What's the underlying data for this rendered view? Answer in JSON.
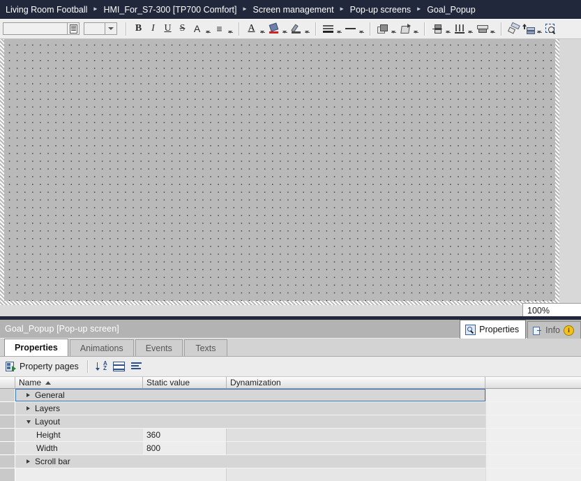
{
  "breadcrumb": {
    "items": [
      {
        "label": "Living Room Football"
      },
      {
        "label": "HMI_For_S7-300 [TP700 Comfort]"
      },
      {
        "label": "Screen management"
      },
      {
        "label": "Pop-up screens"
      },
      {
        "label": "Goal_Popup"
      }
    ],
    "separator": "▸"
  },
  "toolbar": {
    "font_name_value": "",
    "font_name_placeholder": "",
    "font_size_value": "",
    "buttons": [
      {
        "name": "bold",
        "glyph": "B"
      },
      {
        "name": "italic",
        "glyph": "I"
      },
      {
        "name": "underline",
        "glyph": "U"
      },
      {
        "name": "strikethrough",
        "glyph": "S"
      },
      {
        "name": "font-size-grow",
        "glyph": "A"
      },
      {
        "name": "align-text",
        "glyph": "≡"
      },
      {
        "name": "font-color",
        "glyph": "A"
      },
      {
        "name": "fill-color",
        "glyph": "■"
      },
      {
        "name": "line-color",
        "glyph": "╱"
      },
      {
        "name": "border-style",
        "glyph": "≡"
      },
      {
        "name": "line-weight",
        "glyph": "—"
      },
      {
        "name": "order-front",
        "glyph": "▣"
      },
      {
        "name": "rotate",
        "glyph": "↻"
      },
      {
        "name": "align-vertical",
        "glyph": "≡"
      },
      {
        "name": "distribute-horizontal",
        "glyph": "‖"
      },
      {
        "name": "size-equal",
        "glyph": "↔"
      },
      {
        "name": "format-painter",
        "glyph": "✐"
      },
      {
        "name": "arrange",
        "glyph": "↑"
      },
      {
        "name": "zoom-select",
        "glyph": "⌕"
      }
    ]
  },
  "canvas": {
    "zoom_level": "100%"
  },
  "panel": {
    "title": "Goal_Popup [Pop-up screen]",
    "tabs": [
      {
        "label": "Properties",
        "icon": "properties-icon",
        "active": true
      },
      {
        "label": "Info",
        "icon": "info-icon",
        "badge": "i",
        "active": false
      }
    ],
    "subtabs": [
      {
        "label": "Properties",
        "active": true
      },
      {
        "label": "Animations",
        "active": false
      },
      {
        "label": "Events",
        "active": false
      },
      {
        "label": "Texts",
        "active": false
      }
    ],
    "property_pages_label": "Property pages",
    "view_buttons": [
      {
        "name": "sort-alphabetical-button"
      },
      {
        "name": "categorized-view-button"
      },
      {
        "name": "list-view-button"
      }
    ]
  },
  "table": {
    "columns": [
      "Name",
      "Static value",
      "Dynamization"
    ],
    "sort_column": "Name",
    "sort_direction": "asc",
    "rows": [
      {
        "type": "group",
        "label": "General",
        "expanded": false,
        "static_value": "",
        "dynamization": "",
        "selected": true
      },
      {
        "type": "group",
        "label": "Layers",
        "expanded": false,
        "static_value": "",
        "dynamization": "",
        "selected": false
      },
      {
        "type": "group",
        "label": "Layout",
        "expanded": true,
        "static_value": "",
        "dynamization": "",
        "selected": false
      },
      {
        "type": "leaf",
        "label": "Height",
        "static_value": "360",
        "dynamization": "",
        "selected": false
      },
      {
        "type": "leaf",
        "label": "Width",
        "static_value": "800",
        "dynamization": "",
        "selected": false
      },
      {
        "type": "group",
        "label": "Scroll bar",
        "expanded": false,
        "static_value": "",
        "dynamization": "",
        "selected": false
      },
      {
        "type": "empty",
        "label": "",
        "static_value": "",
        "dynamization": "",
        "selected": false
      }
    ]
  }
}
